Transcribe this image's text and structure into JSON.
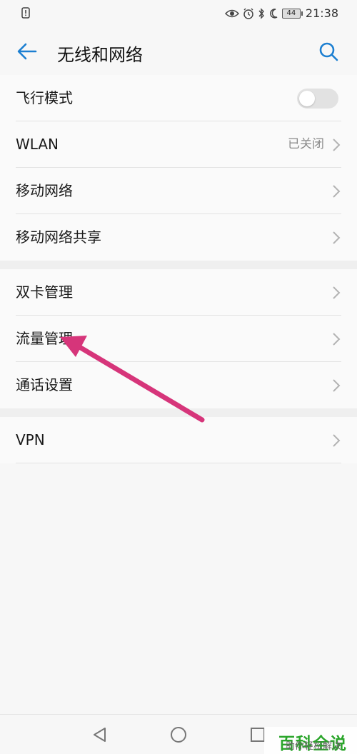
{
  "status_bar": {
    "notification_icon": "sim-alert-icon",
    "icons": [
      "eye-icon",
      "alarm-icon",
      "bluetooth-icon",
      "moon-icon"
    ],
    "battery": "44",
    "time": "21:38"
  },
  "header": {
    "title": "无线和网络",
    "back_icon": "back-arrow-icon",
    "search_icon": "search-icon"
  },
  "groups": [
    {
      "items": [
        {
          "label": "飞行模式",
          "control": "toggle",
          "toggle_on": false
        },
        {
          "label": "WLAN",
          "value": "已关闭",
          "control": "chevron"
        },
        {
          "label": "移动网络",
          "control": "chevron"
        },
        {
          "label": "移动网络共享",
          "control": "chevron"
        }
      ]
    },
    {
      "items": [
        {
          "label": "双卡管理",
          "control": "chevron"
        },
        {
          "label": "流量管理",
          "control": "chevron"
        },
        {
          "label": "通话设置",
          "control": "chevron"
        }
      ]
    },
    {
      "items": [
        {
          "label": "VPN",
          "control": "chevron"
        }
      ]
    }
  ],
  "annotation": {
    "type": "arrow",
    "color": "#d6357a",
    "points_to": "流量管理"
  },
  "nav_bar": {
    "back": "back-triangle-icon",
    "home": "home-circle-icon",
    "recents": "recents-square-icon"
  },
  "watermark": {
    "title": "百科全说",
    "subtitle": "助你轻松解决"
  },
  "colors": {
    "accent": "#1c7fd1",
    "annotation": "#d6357a",
    "watermark": "#2aa52a"
  }
}
